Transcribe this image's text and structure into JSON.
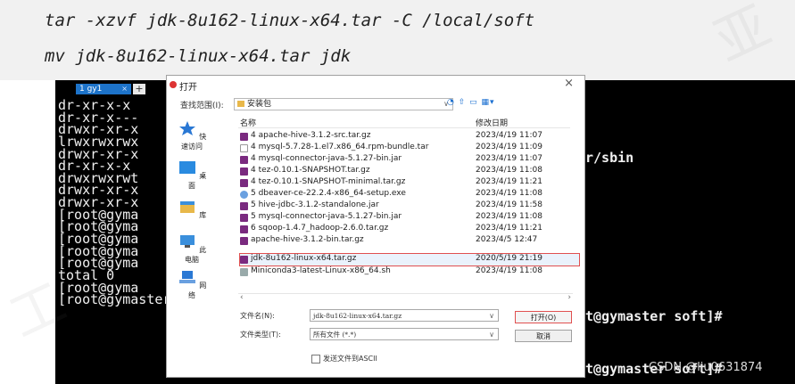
{
  "commands": {
    "line1": "tar -xzvf jdk-8u162-linux-x64.tar  -C /local/soft",
    "line2": "mv jdk-8u162-linux-x64.tar jdk"
  },
  "terminal": {
    "tab_label": "1 gy1",
    "new_tab_label": "+",
    "lines": [
      "dr-xr-x-x",
      "dr-xr-x---",
      "drwxr-xr-x",
      "lrwxrwxrwx",
      "drwxr-xr-x",
      "dr-xr-x-x",
      "drwxrwxrwt",
      "drwxr-xr-x",
      "drwxr-xr-x",
      "[root@gyma",
      "[root@gyma",
      "[root@gyma",
      "[root@gyma",
      "[root@gyma",
      "total 0",
      "[root@gyma",
      "[root@gymaster soft]#"
    ],
    "right_sbin": "r/sbin",
    "right_prompt_1": "t@gymaster soft]#",
    "right_prompt_2": "t@gymaster soft]#"
  },
  "dialog": {
    "title": "打开",
    "close_glyph": "×",
    "look_in_label": "查找范围(I):",
    "look_in_value": "安装包",
    "toolbar_glyphs": "◔ ⇧ ▭ ▦▾",
    "sidebar": [
      {
        "label": "快速访问",
        "icon": "star-icon"
      },
      {
        "label": "桌面",
        "icon": "desktop-icon"
      },
      {
        "label": "库",
        "icon": "library-icon"
      },
      {
        "label": "此电脑",
        "icon": "computer-icon"
      },
      {
        "label": "网络",
        "icon": "network-icon"
      }
    ],
    "columns": {
      "name": "名称",
      "date": "修改日期"
    },
    "files": [
      {
        "name": "4 apache-hive-3.1.2-src.tar.gz",
        "date": "2023/4/19 11:07",
        "icon": "archive"
      },
      {
        "name": "4 mysql-5.7.28-1.el7.x86_64.rpm-bundle.tar",
        "date": "2023/4/19 11:09",
        "icon": "doc"
      },
      {
        "name": "4 mysql-connector-java-5.1.27-bin.jar",
        "date": "2023/4/19 11:07",
        "icon": "archive"
      },
      {
        "name": "4 tez-0.10.1-SNAPSHOT.tar.gz",
        "date": "2023/4/19 11:08",
        "icon": "archive"
      },
      {
        "name": "4 tez-0.10.1-SNAPSHOT-minimal.tar.gz",
        "date": "2023/4/19 11:21",
        "icon": "archive"
      },
      {
        "name": "5 dbeaver-ce-22.2.4-x86_64-setup.exe",
        "date": "2023/4/19 11:08",
        "icon": "exe"
      },
      {
        "name": "5 hive-jdbc-3.1.2-standalone.jar",
        "date": "2023/4/19 11:58",
        "icon": "archive"
      },
      {
        "name": "5 mysql-connector-java-5.1.27-bin.jar",
        "date": "2023/4/19 11:08",
        "icon": "archive"
      },
      {
        "name": "6 sqoop-1.4.7_hadoop-2.6.0.tar.gz",
        "date": "2023/4/19 11:21",
        "icon": "archive"
      },
      {
        "name": "apache-hive-3.1.2-bin.tar.gz",
        "date": "2023/4/5 12:47",
        "icon": "archive"
      },
      {
        "name": "jdk-8u162-linux-x64.tar.gz",
        "date": "2020/5/19 21:19",
        "icon": "archive",
        "selected": true
      },
      {
        "name": "Miniconda3-latest-Linux-x86_64.sh",
        "date": "2023/4/19 11:08",
        "icon": "sh"
      }
    ],
    "filename_label": "文件名(N):",
    "filename_value": "jdk-8u162-linux-x64.tar.gz",
    "filetype_label": "文件类型(T):",
    "filetype_value": "所有文件 (*.*)",
    "open_button": "打开(O)",
    "cancel_button": "取消",
    "send_ascii_label": "发送文件到ASCII"
  },
  "credit": "CSDN @liu0631874",
  "colors": {
    "terminal_bg": "#000000",
    "terminal_fg": "#f0f0f0",
    "tab_active": "#1d73c9",
    "selection_border": "#e05050"
  }
}
